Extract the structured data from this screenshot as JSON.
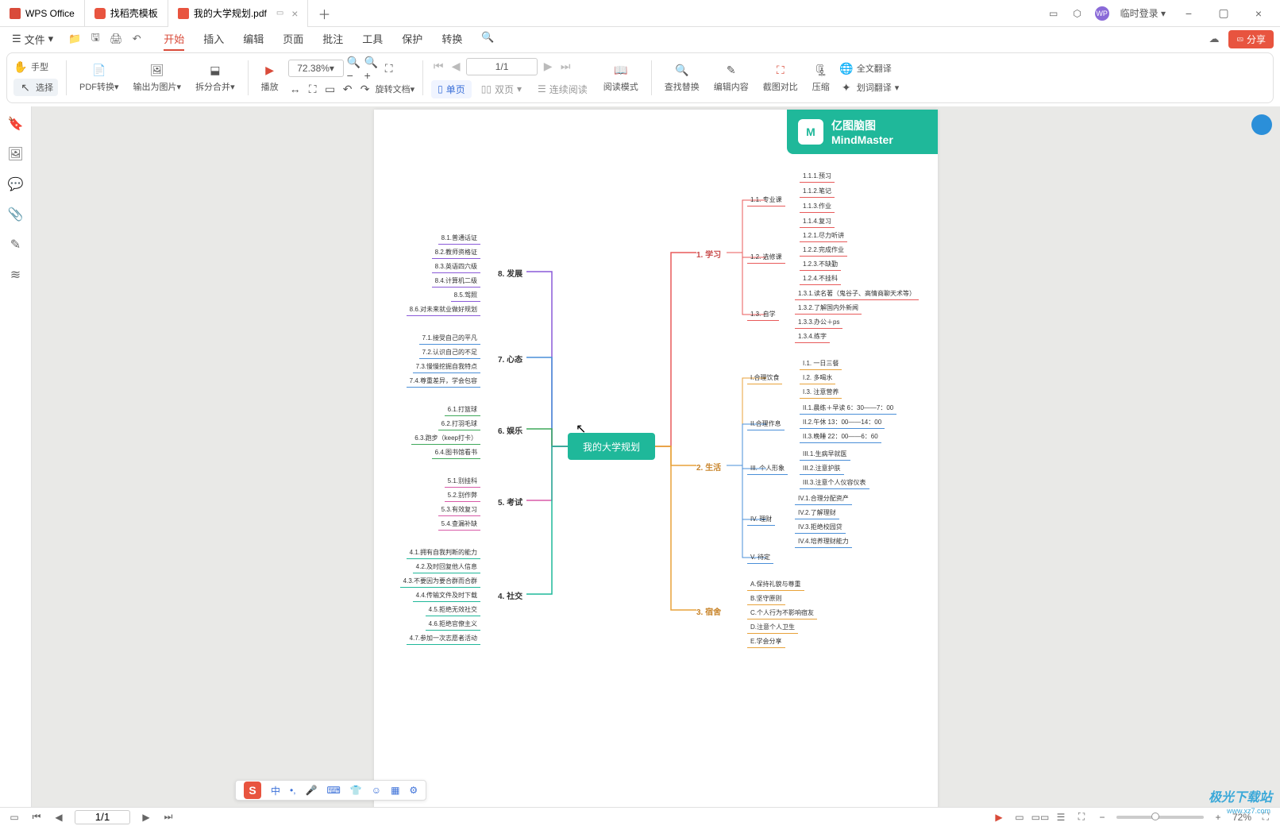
{
  "titlebar": {
    "tabs": [
      {
        "label": "WPS Office",
        "icon": "wps"
      },
      {
        "label": "找稻壳模板",
        "icon": "stk"
      },
      {
        "label": "我的大学规划.pdf",
        "icon": "pdf",
        "active": true
      }
    ],
    "login": "临时登录"
  },
  "menurow": {
    "file": "文件",
    "tabs": [
      "开始",
      "插入",
      "编辑",
      "页面",
      "批注",
      "工具",
      "保护",
      "转换"
    ],
    "share": "分享"
  },
  "toolbar": {
    "hand": "手型",
    "select": "选择",
    "pdf_convert": "PDF转换",
    "export_img": "输出为图片",
    "split_merge": "拆分合并",
    "play": "播放",
    "zoom": "72.38%",
    "page": "1/1",
    "rotate": "旋转文档",
    "single": "单页",
    "double": "双页",
    "continuous": "连续阅读",
    "read_mode": "阅读模式",
    "find_replace": "查找替换",
    "edit_content": "编辑内容",
    "crop_compare": "截图对比",
    "compress": "压缩",
    "full_translate": "全文翻译",
    "word_translate": "划词翻译"
  },
  "mindmap": {
    "brand1": "亿图脑图",
    "brand2": "MindMaster",
    "center": "我的大学规划",
    "b1": {
      "title": "1. 学习",
      "s1": {
        "title": "1.1. 专业课",
        "items": [
          "1.1.1.预习",
          "1.1.2.笔记",
          "1.1.3.作业",
          "1.1.4.复习"
        ]
      },
      "s2": {
        "title": "1.2. 选修课",
        "items": [
          "1.2.1.尽力听讲",
          "1.2.2.完成作业",
          "1.2.3.不缺勤",
          "1.2.4.不挂科"
        ]
      },
      "s3": {
        "title": "1.3. 自学",
        "items": [
          "1.3.1.读名著（鬼谷子、高情商聊天术等）",
          "1.3.2.了解国内外新闻",
          "1.3.3.办公＋ps",
          "1.3.4.练字"
        ]
      }
    },
    "b2": {
      "title": "2. 生活",
      "s1": {
        "title": "I.合理饮食",
        "items": [
          "I.1. 一日三餐",
          "I.2. 多喝水",
          "I.3. 注意营养"
        ]
      },
      "s2": {
        "title": "II.合理作息",
        "items": [
          "II.1.晨练＋早读 6：30——7：00",
          "II.2.午休 13：00——14：00",
          "II.3.晚睡 22：00——6：60"
        ]
      },
      "s3": {
        "title": "III. 个人形象",
        "items": [
          "III.1.生病早就医",
          "III.2.注意护肤",
          "III.3.注意个人仪容仪表"
        ]
      },
      "s4": {
        "title": "IV. 理财",
        "items": [
          "IV.1.合理分配资产",
          "IV.2.了解理财",
          "IV.3.拒绝校园贷",
          "IV.4.培养理财能力"
        ]
      },
      "s5": {
        "title": "V. 待定"
      }
    },
    "b3": {
      "title": "3. 宿舍",
      "items": [
        "A.保持礼貌与尊重",
        "B.坚守原则",
        "C.个人行为不影响宿友",
        "D.注意个人卫生",
        "E.学会分享"
      ]
    },
    "b4": {
      "title": "4. 社交",
      "items": [
        "4.1.拥有自我判断的能力",
        "4.2.及时回复他人信息",
        "4.3.不要因为要合群而合群",
        "4.4.传输文件及时下载",
        "4.5.拒绝无效社交",
        "4.6.拒绝官僚主义",
        "4.7.参加一次志愿者活动"
      ]
    },
    "b5": {
      "title": "5. 考试",
      "items": [
        "5.1.别挂科",
        "5.2.别作弊",
        "5.3.有效复习",
        "5.4.查漏补缺"
      ]
    },
    "b6": {
      "title": "6. 娱乐",
      "items": [
        "6.1.打篮球",
        "6.2.打羽毛球",
        "6.3.跑步（keep打卡）",
        "6.4.图书馆看书"
      ]
    },
    "b7": {
      "title": "7. 心态",
      "items": [
        "7.1.接受自己的平凡",
        "7.2.认识自己的不足",
        "7.3.慢慢挖掘自我特点",
        "7.4.尊重差异，学会包容"
      ]
    },
    "b8": {
      "title": "8. 发展",
      "items": [
        "8.1.普通话证",
        "8.2.教师资格证",
        "8.3.英语四六级",
        "8.4.计算机二级",
        "8.5.驾照",
        "8.6.对未来就业做好规划"
      ]
    }
  },
  "ime": {
    "lang": "中"
  },
  "status": {
    "page": "1/1",
    "zoom": "72%"
  },
  "watermark": {
    "name": "极光下载站",
    "url": "www.xz7.com"
  }
}
